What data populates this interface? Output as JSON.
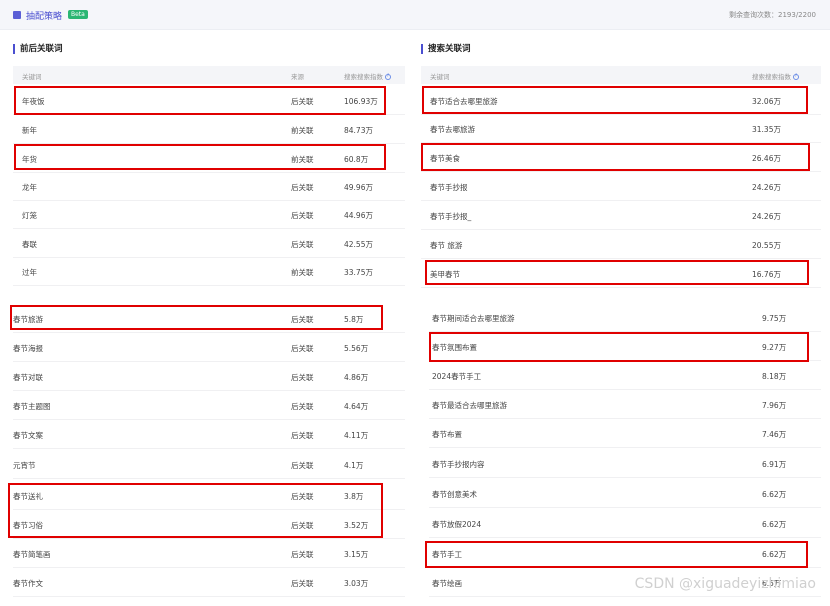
{
  "header": {
    "title": "抽配策略",
    "badge": "Beta",
    "quota": "剩余查询次数：2193/2200"
  },
  "left": {
    "title": "前后关联词",
    "columns": [
      "关键词",
      "来源",
      "搜索搜索指数"
    ],
    "rows": [
      {
        "kw": "年夜饭",
        "src": "后关联",
        "idx": "106.93万"
      },
      {
        "kw": "新年",
        "src": "前关联",
        "idx": "84.73万"
      },
      {
        "kw": "年货",
        "src": "前关联",
        "idx": "60.8万"
      },
      {
        "kw": "龙年",
        "src": "后关联",
        "idx": "49.96万"
      },
      {
        "kw": "灯笼",
        "src": "后关联",
        "idx": "44.96万"
      },
      {
        "kw": "春联",
        "src": "后关联",
        "idx": "42.55万"
      },
      {
        "kw": "过年",
        "src": "前关联",
        "idx": "33.75万"
      },
      {
        "kw": "春节旅游",
        "src": "后关联",
        "idx": "5.8万"
      },
      {
        "kw": "春节海报",
        "src": "后关联",
        "idx": "5.56万"
      },
      {
        "kw": "春节对联",
        "src": "后关联",
        "idx": "4.86万"
      },
      {
        "kw": "春节主题图",
        "src": "后关联",
        "idx": "4.64万"
      },
      {
        "kw": "春节文案",
        "src": "后关联",
        "idx": "4.11万"
      },
      {
        "kw": "元宵节",
        "src": "后关联",
        "idx": "4.1万"
      },
      {
        "kw": "春节送礼",
        "src": "后关联",
        "idx": "3.8万"
      },
      {
        "kw": "春节习俗",
        "src": "后关联",
        "idx": "3.52万"
      },
      {
        "kw": "春节简笔画",
        "src": "后关联",
        "idx": "3.15万"
      },
      {
        "kw": "春节作文",
        "src": "后关联",
        "idx": "3.03万"
      }
    ]
  },
  "right": {
    "title": "搜索关联词",
    "columns": [
      "关键词",
      "搜索搜索指数"
    ],
    "rows": [
      {
        "kw": "春节适合去哪里旅游",
        "idx": "32.06万"
      },
      {
        "kw": "春节去哪旅游",
        "idx": "31.35万"
      },
      {
        "kw": "春节美食",
        "idx": "26.46万"
      },
      {
        "kw": "春节手抄报",
        "idx": "24.26万"
      },
      {
        "kw": "春节手抄报_",
        "idx": "24.26万"
      },
      {
        "kw": "春节 旅游",
        "idx": "20.55万"
      },
      {
        "kw": "美甲春节",
        "idx": "16.76万"
      },
      {
        "kw": "春节期间适合去哪里旅游",
        "idx": "9.75万"
      },
      {
        "kw": "春节氛围布置",
        "idx": "9.27万"
      },
      {
        "kw": "2024春节手工",
        "idx": "8.18万"
      },
      {
        "kw": "春节最适合去哪里旅游",
        "idx": "7.96万"
      },
      {
        "kw": "春节布置",
        "idx": "7.46万"
      },
      {
        "kw": "春节手抄报内容",
        "idx": "6.91万"
      },
      {
        "kw": "春节创意美术",
        "idx": "6.62万"
      },
      {
        "kw": "春节放假2024",
        "idx": "6.62万"
      },
      {
        "kw": "春节手工",
        "idx": "6.62万"
      },
      {
        "kw": "春节绘画",
        "idx": "6.5万"
      }
    ]
  },
  "watermark": "CSDN @xiguadeyizhimiao"
}
